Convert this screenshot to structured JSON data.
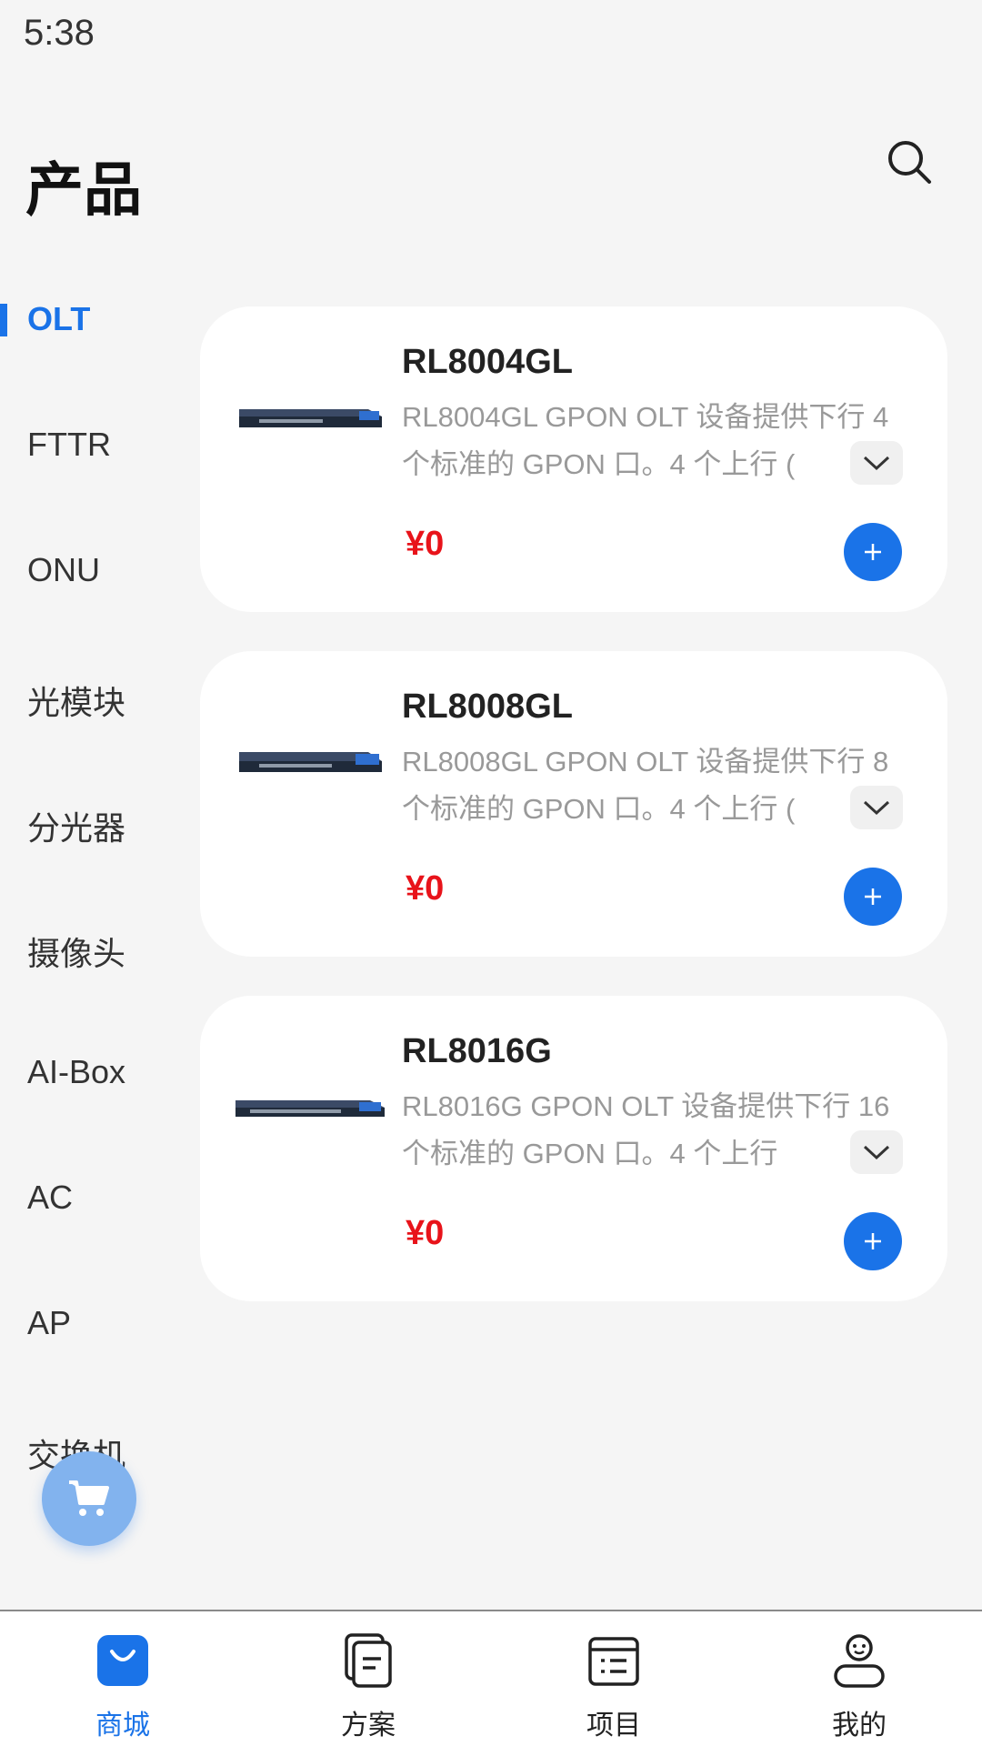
{
  "status_bar": {
    "time": "5:38"
  },
  "header": {
    "title": "产品",
    "search_icon": "search-icon"
  },
  "categories": [
    {
      "label": "OLT",
      "active": true
    },
    {
      "label": "FTTR",
      "active": false
    },
    {
      "label": "ONU",
      "active": false
    },
    {
      "label": "光模块",
      "active": false
    },
    {
      "label": "分光器",
      "active": false
    },
    {
      "label": "摄像头",
      "active": false
    },
    {
      "label": "AI-Box",
      "active": false
    },
    {
      "label": "AC",
      "active": false
    },
    {
      "label": "AP",
      "active": false
    },
    {
      "label": "交换机",
      "active": false
    }
  ],
  "products": [
    {
      "name": "RL8004GL",
      "description": "RL8004GL GPON OLT 设备提供下行 4 个标准的 GPON 口。4 个上行 (",
      "price": "¥0"
    },
    {
      "name": "RL8008GL",
      "description": "RL8008GL GPON OLT 设备提供下行 8 个标准的 GPON 口。4 个上行 (",
      "price": "¥0"
    },
    {
      "name": "RL8016G",
      "description": "RL8016G GPON OLT 设备提供下行 16 个标准的 GPON 口。4 个上行",
      "price": "¥0"
    }
  ],
  "cart": {
    "icon": "cart-icon"
  },
  "bottom_nav": [
    {
      "label": "商城",
      "icon": "shopping-bag-icon",
      "active": true
    },
    {
      "label": "方案",
      "icon": "document-icon",
      "active": false
    },
    {
      "label": "项目",
      "icon": "list-icon",
      "active": false
    },
    {
      "label": "我的",
      "icon": "user-icon",
      "active": false
    }
  ],
  "colors": {
    "accent": "#1a73e8",
    "price": "#e8131a",
    "background": "#f5f5f5",
    "card": "#ffffff",
    "cart_fab": "#82b3ee"
  }
}
